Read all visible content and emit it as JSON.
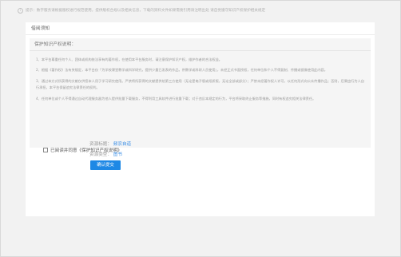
{
  "tipbar": {
    "icon": "info-icon",
    "text": "提示：数字服务请根据版权进行规范使用，提供版权合规以及相关信息，下载的资料文件如果需要引用请注明出处 请自觉遵守知识产权保护相关规定"
  },
  "card": {
    "title": "借阅须知",
    "notice": {
      "title": "保护知识产权说明：",
      "paragraphs": [
        "1、本平台尊重任何个人、团体或机构依法享有的著作权，在使用本平台服务时，请注意保护知识产权，维护作者的合法权益。",
        "2、根据《著作权》法有关规定，本平台仅「为学校课堂教学或科学研究，提供少量已发表的作品，供教学或科研人员使用」，未经正式书面授权，任何单位和个人不得复制、传播或镜像使用此内容。",
        "3、通过本方式所获得的文献仅供您本人用于学习研究使用。严禁将所获得的文献提供给第三方使用（无论是电子版或纸质版，无论全部或部分）；严禁未经著作权人许可，以任何形式向公众传播作品；否则，后果由行为人自行承担，本平台保留追究法律责任的权利。",
        "4、任何单位或个人不得通过自动代理服务器为他人提供批量下载服务，不得利用工具软件进行批量下载；对于违反本规定的行为，平台将采取终止服务等措施，同时有权追究相关法律责任。"
      ]
    },
    "resource": {
      "title_label": "资源标题：",
      "title_value": "频农自道",
      "type_label": "资源类型：",
      "type_value": "图书"
    },
    "agree_label": "已阅读并同意《保护知识产权说明》",
    "agree_checked": false,
    "submit_label": "确认提交"
  }
}
